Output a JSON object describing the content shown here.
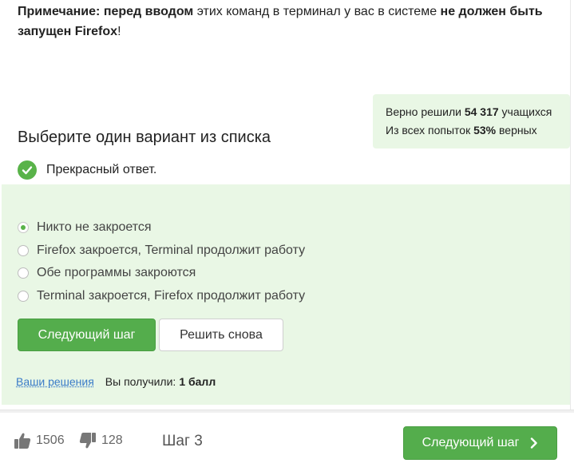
{
  "note": {
    "prefix": "Примечание:",
    "bold_1": "перед вводом",
    "text_1": "этих команд в терминал у вас в системе",
    "bold_2": "не должен быть запущен Firefox",
    "suffix": "!"
  },
  "stats": {
    "solved_prefix": "Верно решили",
    "solved_count": "54 317",
    "solved_suffix": "учащихся",
    "attempts_prefix": "Из всех попыток",
    "attempts_percent": "53%",
    "attempts_suffix": "верных"
  },
  "quiz": {
    "title": "Выберите один вариант из списка",
    "feedback": "Прекрасный ответ.",
    "options": [
      {
        "label": "Никто не закроется",
        "selected": true
      },
      {
        "label": "Firefox закроется, Terminal продолжит работу",
        "selected": false
      },
      {
        "label": "Обе программы закроются",
        "selected": false
      },
      {
        "label": "Terminal закроется, Firefox продолжит работу",
        "selected": false
      }
    ],
    "next_button": "Следующий шаг",
    "retry_button": "Решить снова",
    "solutions_link": "Ваши решения",
    "score_label": "Вы получили:",
    "score_value": "1 балл"
  },
  "footer": {
    "likes": "1506",
    "dislikes": "128",
    "step": "Шаг 3",
    "next_button": "Следующий шаг"
  },
  "colors": {
    "accent_green": "#54ad4c",
    "panel_bg": "#e9f7e5",
    "link": "#3a7bc8"
  }
}
